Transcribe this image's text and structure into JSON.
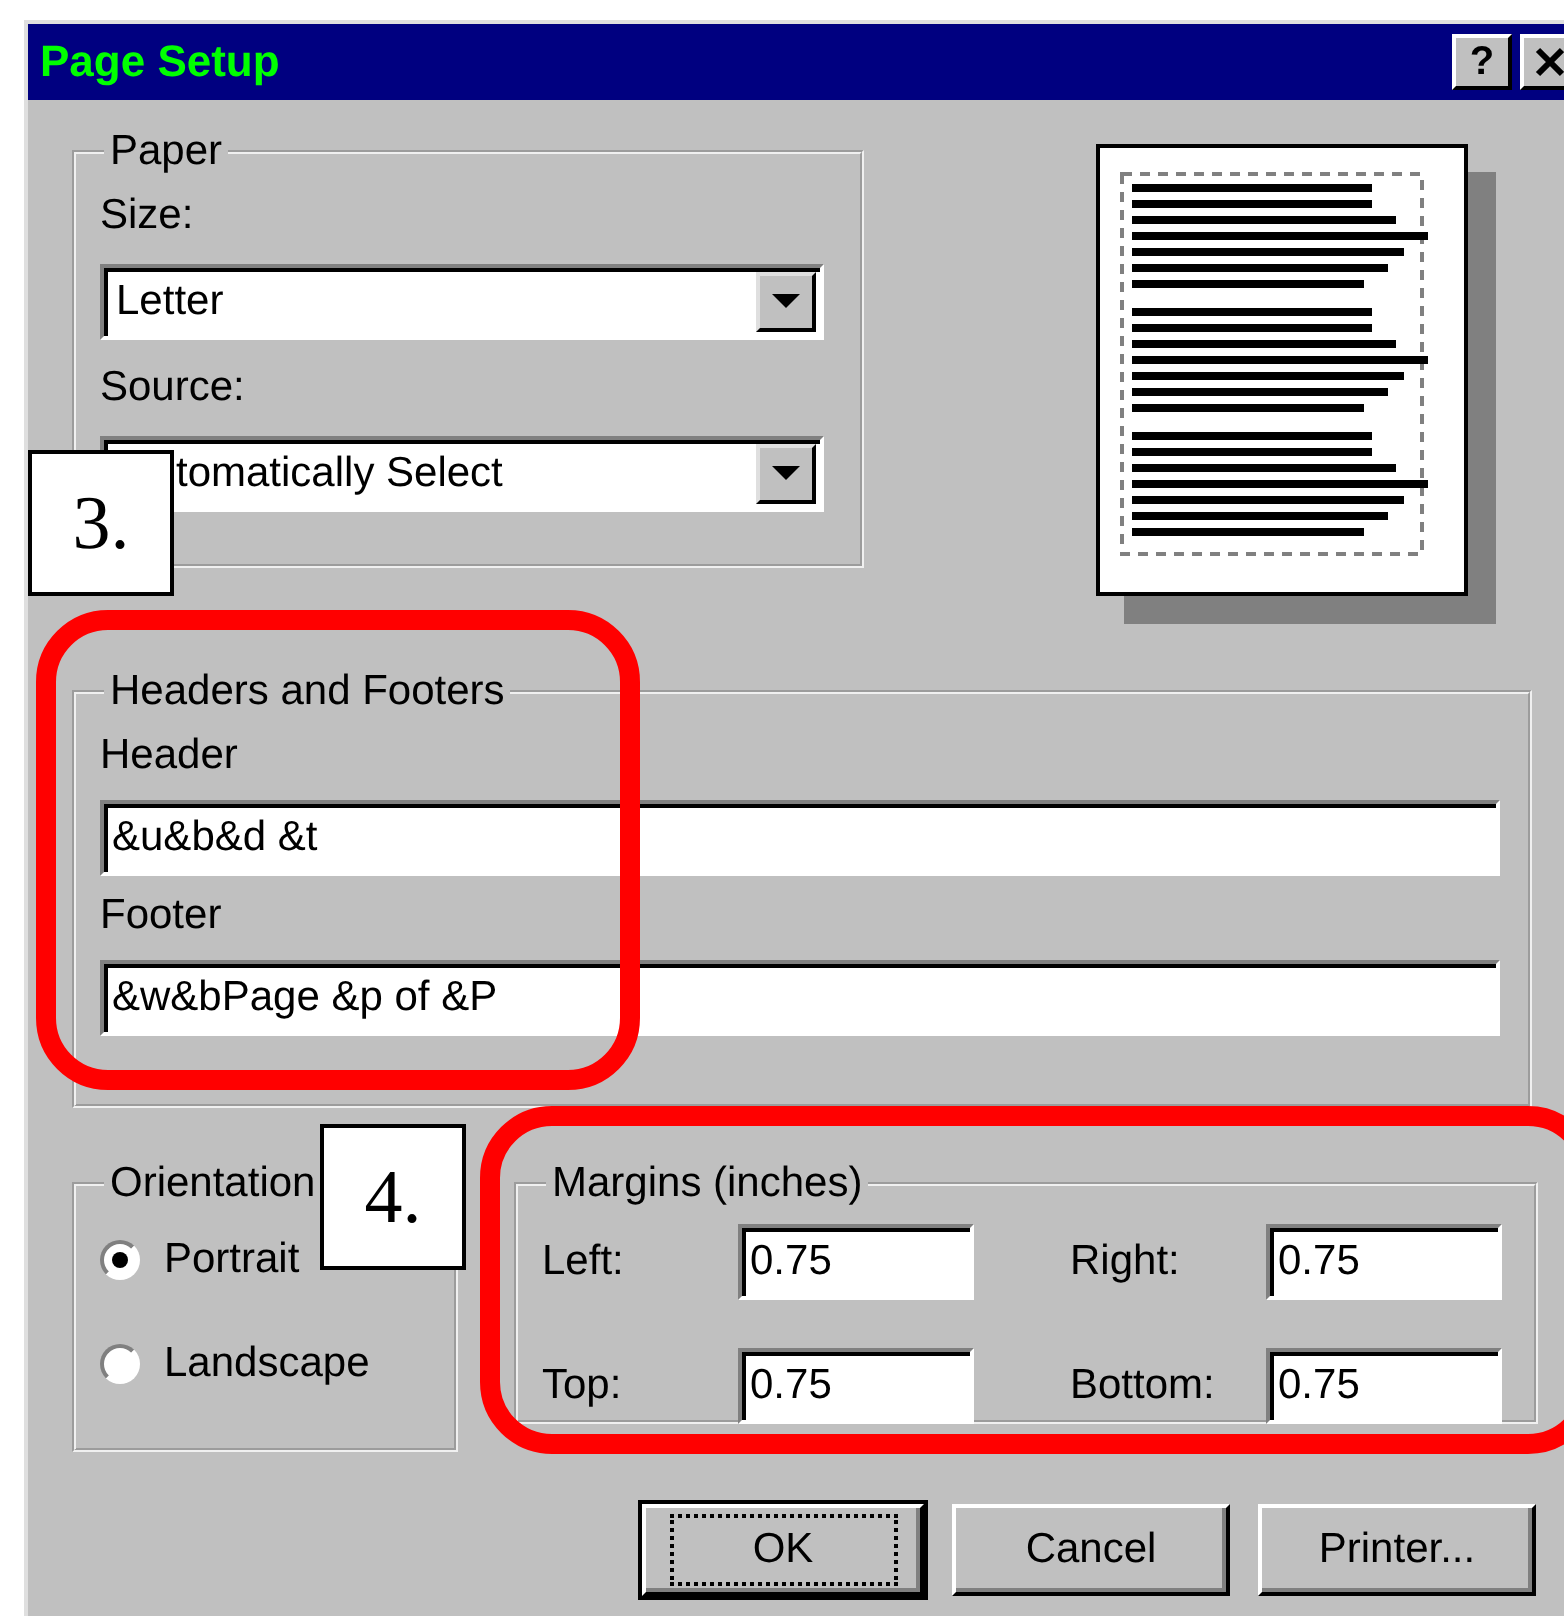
{
  "window": {
    "title": "Page Setup",
    "help_button": "?"
  },
  "paper": {
    "legend": "Paper",
    "size_label": "Size:",
    "size_value": "Letter",
    "source_label": "Source:",
    "source_value": "tomatically Select"
  },
  "headers_footers": {
    "legend": "Headers and Footers",
    "header_label": "Header",
    "header_value": "&u&b&d &t",
    "footer_label": "Footer",
    "footer_value": "&w&bPage &p of &P"
  },
  "orientation": {
    "legend": "Orientation",
    "options": [
      {
        "label": "Portrait",
        "selected": true
      },
      {
        "label": "Landscape",
        "selected": false
      }
    ]
  },
  "margins": {
    "legend": "Margins (inches)",
    "fields": [
      {
        "label": "Left:",
        "value": "0.75"
      },
      {
        "label": "Right:",
        "value": "0.75"
      },
      {
        "label": "Top:",
        "value": "0.75"
      },
      {
        "label": "Bottom:",
        "value": "0.75"
      }
    ]
  },
  "buttons": [
    {
      "label": "OK",
      "default": true
    },
    {
      "label": "Cancel",
      "default": false
    },
    {
      "label": "Printer...",
      "default": false
    }
  ],
  "annotations": [
    {
      "kind": "callout",
      "label": "3."
    },
    {
      "kind": "callout",
      "label": "4."
    },
    {
      "kind": "highlight"
    },
    {
      "kind": "highlight"
    }
  ]
}
